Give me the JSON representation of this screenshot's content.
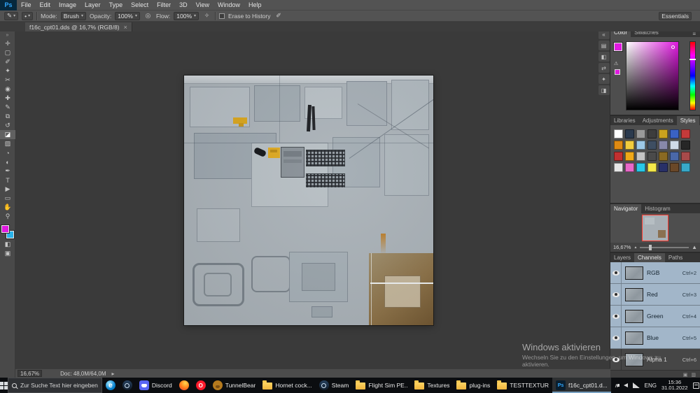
{
  "window": {
    "logo": "Ps",
    "menus": [
      "File",
      "Edit",
      "Image",
      "Layer",
      "Type",
      "Select",
      "Filter",
      "3D",
      "View",
      "Window",
      "Help"
    ]
  },
  "options_bar": {
    "tool_glyph": "✎",
    "preset_glyph": "•",
    "caret": "▾",
    "mode_label": "Mode:",
    "mode_value": "Brush",
    "opacity_label": "Opacity:",
    "opacity_value": "100%",
    "pressure_opacity_glyph": "◎",
    "flow_label": "Flow:",
    "flow_value": "100%",
    "airbrush_glyph": "✧",
    "erase_history_label": "Erase to History",
    "pressure_size_glyph": "✐",
    "workspace": "Essentials"
  },
  "document_tab": {
    "title": "f16c_cpt01.dds @ 16,7% (RGB/8)",
    "close_glyph": "×"
  },
  "toolbar": {
    "collapse_glyph": "»",
    "tools": [
      {
        "name": "tool-move",
        "glyph": "✛"
      },
      {
        "name": "tool-marquee",
        "glyph": "▢"
      },
      {
        "name": "tool-lasso",
        "glyph": "✐"
      },
      {
        "name": "tool-quick-selection",
        "glyph": "✦"
      },
      {
        "name": "tool-crop",
        "glyph": "✂"
      },
      {
        "name": "tool-eyedropper",
        "glyph": "◉"
      },
      {
        "name": "tool-healing-brush",
        "glyph": "✚"
      },
      {
        "name": "tool-brush",
        "glyph": "✎"
      },
      {
        "name": "tool-clone-stamp",
        "glyph": "⧉"
      },
      {
        "name": "tool-history-brush",
        "glyph": "↺"
      },
      {
        "name": "tool-eraser",
        "glyph": "◪",
        "selected": true
      },
      {
        "name": "tool-gradient",
        "glyph": "▨"
      },
      {
        "name": "tool-blur",
        "glyph": "◔"
      },
      {
        "name": "tool-dodge",
        "glyph": "◐"
      },
      {
        "name": "tool-pen",
        "glyph": "✒"
      },
      {
        "name": "tool-type",
        "glyph": "T"
      },
      {
        "name": "tool-path-selection",
        "glyph": "▶"
      },
      {
        "name": "tool-shape",
        "glyph": "▭"
      },
      {
        "name": "tool-hand",
        "glyph": "✋"
      },
      {
        "name": "tool-zoom",
        "glyph": "⚲"
      }
    ],
    "quick_mask_glyph": "◧",
    "screen_mode_glyph": "▣"
  },
  "colors": {
    "foreground": "#e01ae0",
    "background": "#2ab3ea"
  },
  "panels": {
    "collapsed_icons": [
      "«",
      "▤",
      "◧",
      "⇄",
      "✦",
      "◨"
    ],
    "color": {
      "tabs": [
        {
          "label": "Color",
          "active": true
        },
        {
          "label": "Swatches",
          "active": false
        }
      ],
      "menu_glyph": "≡",
      "warning_glyph": "⚠"
    },
    "styles": {
      "tabs": [
        {
          "label": "Libraries",
          "active": false
        },
        {
          "label": "Adjustments",
          "active": false
        },
        {
          "label": "Styles",
          "active": true
        }
      ],
      "menu_glyph": "≡",
      "swatches": [
        "#ffffff",
        "#2b3a4e",
        "#9a9a9a",
        "#3d3d3d",
        "#caa21e",
        "#3a62c4",
        "#c43a3a",
        "#e08a12",
        "#f2cc3e",
        "#9cc8e8",
        "#3e4e62",
        "#8888aa",
        "#d0dce8",
        "#262626",
        "#c23030",
        "#f0a818",
        "#c4c4c4",
        "#4a4a4a",
        "#8a6a22",
        "#4a68a8",
        "#a84a4a",
        "#e6e6e6",
        "#e868c8",
        "#28c8e8",
        "#f4e84a",
        "#283068",
        "#6a4828",
        "#38a8c8"
      ]
    },
    "navigator": {
      "tabs": [
        {
          "label": "Navigator",
          "active": true
        },
        {
          "label": "Histogram",
          "active": false
        }
      ],
      "menu_glyph": "≡",
      "zoom": "16,67%",
      "zoom_out_glyph": "▲",
      "zoom_in_glyph": "▲"
    },
    "layers": {
      "tabs": [
        {
          "label": "Layers",
          "active": false
        },
        {
          "label": "Channels",
          "active": true
        },
        {
          "label": "Paths",
          "active": false
        }
      ],
      "menu_glyph": "≡",
      "channels": [
        {
          "name": "RGB",
          "shortcut": "Ctrl+2",
          "selected": true
        },
        {
          "name": "Red",
          "shortcut": "Ctrl+3",
          "selected": true
        },
        {
          "name": "Green",
          "shortcut": "Ctrl+4",
          "selected": true
        },
        {
          "name": "Blue",
          "shortcut": "Ctrl+5",
          "selected": true
        },
        {
          "name": "Alpha 1",
          "shortcut": "Ctrl+6",
          "selected": false,
          "alpha": true
        }
      ]
    }
  },
  "status_bar": {
    "zoom": "16,67%",
    "doc": "Doc: 48,0M/64,0M",
    "arrow_glyph": "▸"
  },
  "watermark": {
    "title": "Windows aktivieren",
    "subtitle": "Wechseln Sie zu den Einstellungen, um Windows zu aktivieren."
  },
  "taskbar": {
    "search_placeholder": "Zur Suche Text hier eingeben",
    "items": [
      {
        "type": "edge",
        "glyph": "e",
        "bg": "",
        "label": ""
      },
      {
        "type": "steam",
        "glyph": "",
        "bg": "",
        "label": ""
      },
      {
        "type": "discord",
        "glyph": "",
        "bg": "",
        "label": "Discord"
      },
      {
        "type": "firefox",
        "glyph": "",
        "bg": "",
        "label": ""
      },
      {
        "type": "opera",
        "glyph": "O",
        "bg": "",
        "label": ""
      },
      {
        "type": "tunnelbear",
        "glyph": "",
        "bg": "",
        "label": "TunnelBear"
      },
      {
        "type": "folder",
        "glyph": "",
        "bg": "",
        "label": "Hornet cock..."
      },
      {
        "type": "steam",
        "glyph": "",
        "bg": "",
        "label": "Steam"
      },
      {
        "type": "folder",
        "glyph": "",
        "bg": "",
        "label": "Flight Sim PE..."
      },
      {
        "type": "folder",
        "glyph": "",
        "bg": "",
        "label": "Textures"
      },
      {
        "type": "folder",
        "glyph": "",
        "bg": "",
        "label": "plug-ins"
      },
      {
        "type": "folder",
        "glyph": "",
        "bg": "",
        "label": "TESTTEXTUR"
      },
      {
        "type": "ps",
        "glyph": "Ps",
        "bg": "",
        "label": "f16c_cpt01.d...",
        "active": true
      }
    ],
    "tray": {
      "chevron": "∧",
      "lang": "ENG",
      "time": "15:36",
      "date": "31.01.2022"
    }
  }
}
